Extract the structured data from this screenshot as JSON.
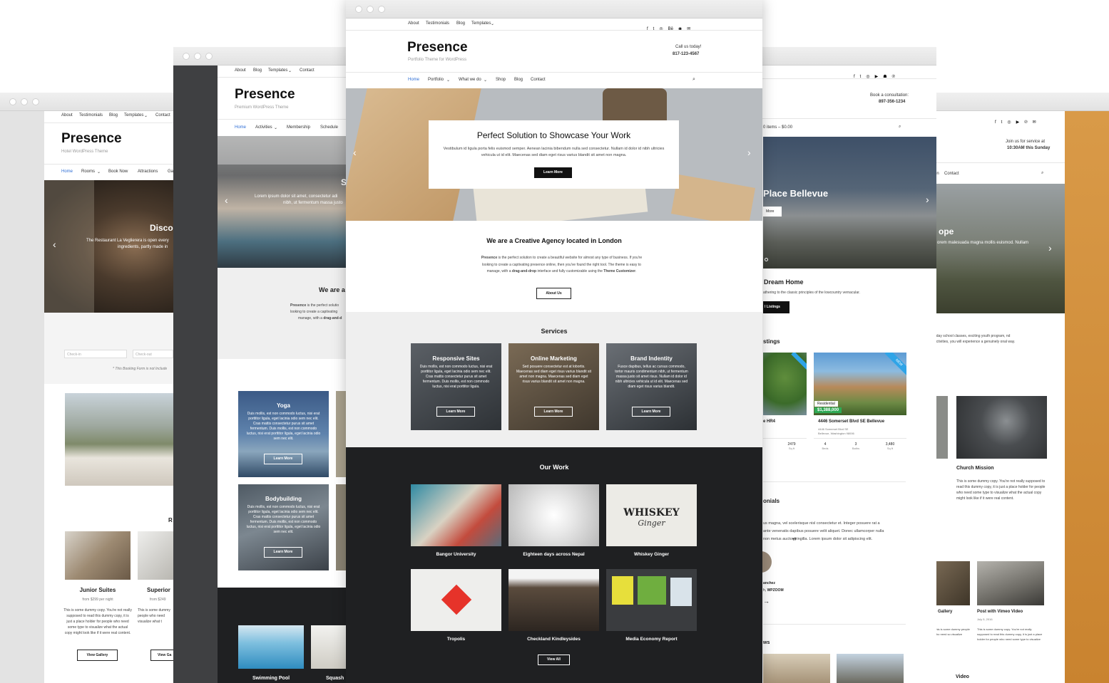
{
  "left_window": {
    "nav": [
      "About",
      "Testimonials",
      "Blog",
      "Templates",
      "Contact"
    ],
    "logo": "Presence",
    "tagline": "Hotel WordPress Theme",
    "menu": [
      "Home",
      "Rooms",
      "Book Now",
      "Attractions",
      "Ga"
    ],
    "hero_title": "Disco",
    "hero_text": "The Restaurant La Veglierera is open every",
    "hero_text2": "ingredients, partly made in",
    "checkin": "Check-in",
    "checkout": "Check-out",
    "booking_note": "* This Booking Form is not Include",
    "rooms_heading": "R",
    "room1_title": "Junior Suites",
    "room1_price": "from $299 per night",
    "room2_title": "Superior",
    "room2_price": "from $249",
    "room_text": "This is some dummy copy. You're not really supposed to read this dummy copy, it is just a place holder for people who need some type to visualize what the actual copy might look like if it were real content.",
    "room_text2": "This is some dummy people who need visualize what t",
    "room1_button": "View Gallery",
    "room2_button": "View Ga"
  },
  "second_window": {
    "nav": [
      "About",
      "Blog",
      "Templates",
      "Contact"
    ],
    "logo": "Presence",
    "tagline": "Premium WordPress Theme",
    "menu": [
      "Home",
      "Activities",
      "Membership",
      "Schedule"
    ],
    "hero_letter": "S",
    "hero_text": "Lorem ipsum dolor sit amet, consectetur adi",
    "hero_text2": "nibh, ut fermentum massa justo",
    "about_heading": "We are a",
    "about_bold": "Presence",
    "about_text": "is the perfect solutio",
    "about_text2": "looking to create a captivating",
    "about_text3": "manage, with a",
    "about_bold2": "drag-and-d",
    "card1_title": "Yoga",
    "card2_title": "Bodybuilding",
    "card_text": "Duis mollis, est non commodo luctus, nisi erat porttitor ligula, eget lacinia odio sem nec elit. Cras mattis consectetur purus sit amet fermentum. Duis mollis, est non commodo luctus, nisi erat porttitor ligula, eget lacinia odio sem nec elit.",
    "card_button": "Learn More",
    "bottom1": "Swimming Pool",
    "bottom2": "Squash"
  },
  "center_window": {
    "nav": [
      "About",
      "Testimonials",
      "Blog",
      "Templates"
    ],
    "social": [
      "f",
      "t",
      "◎",
      "Bē",
      "◉",
      "✉"
    ],
    "logo": "Presence",
    "tagline": "Portfolio Theme for WordPress",
    "call_label": "Call us today!",
    "phone": "817-123-4567",
    "menu": [
      "Home",
      "Portfolio",
      "What we do",
      "Shop",
      "Blog",
      "Contact"
    ],
    "hero_title": "Perfect Solution to Showcase Your Work",
    "hero_text": "Vestibulum id ligula porta felis euismod semper. Aenean lacinia bibendum nulla sed consectetur. Nullam id dolor id nibh ultricies vehicula ut id elit. Maecenas sed diam eget risus varius blandit sit amet non magna.",
    "hero_button": "Learn More",
    "about_heading": "We are a Creative Agency located in London",
    "about_bold": "Presence",
    "about_text": "is the perfect solution to create a beautiful website for almost any type of business. If you're looking to create a captivating presence online, then you've found the right tool. The theme is easy to manage, with a",
    "about_bold2": "drag-and-drop",
    "about_text2": "interface and fully customizable using the",
    "about_bold3": "Theme Customizer",
    "about_button": "About Us",
    "services_heading": "Services",
    "services": [
      {
        "title": "Responsive Sites",
        "text": "Duis mollis, est non commodo luctus, nisi erat porttitor ligula, eget lacinia odio sem nec elit. Cras mattis consectetur purus sit amet fermentum. Duis mollis, est non commodo luctus, nisi erat porttitor ligula.",
        "button": "Learn More"
      },
      {
        "title": "Online Marketing",
        "text": "Sed posuere consectetur est at lobortis. Maecenas sed diam eget risus varius blandit sit amet non magna. Maecenas sed diam eget risus varius blandit sit amet non magna.",
        "button": "Learn More"
      },
      {
        "title": "Brand Indentity",
        "text": "Fusce dapibus, tellus ac cursus commodo, tortor mauris condimentum nibh, ut fermentum massa justo sit amet risus. Nullam id dolor id nibh ultricies vehicula ut id elit. Maecenas sed diam eget risus varius blandit.",
        "button": "Learn More"
      }
    ],
    "work_heading": "Our Work",
    "work": [
      "Bangor University",
      "Eighteen days across Nepal",
      "Whiskey Ginger",
      "Tropolis",
      "Checkland Kindleysides",
      "Media Economy Report"
    ],
    "work_button": "View All"
  },
  "fourth_window": {
    "social": [
      "f",
      "t",
      "◎",
      "▶",
      "☗",
      "℗"
    ],
    "book_label": "Book a consultation:",
    "phone": "897-356-1234",
    "cart": "0 items – $0.00",
    "hero_title": "Place Bellevue",
    "hero_button": "More",
    "dream_title": "Dream Home",
    "dream_text": "athering to the classic principles of the lowcountry vernacular.",
    "dream_button": "l Listings",
    "listings_heading": "stings",
    "listing_name": "4446 Somerset Blvd SE Bellevue",
    "listing_addr": "4446 Somerset Blvd SE",
    "listing_city": "Bellevue, Washington 98006",
    "listing_type": "Residential",
    "listing_price": "$1,388,000",
    "listing_ribbon": "NEW",
    "left_listing_name": "e HR4",
    "left_sqft": "2479",
    "left_sqft_label": "Sq ft",
    "beds": "4",
    "beds_label": "Beds",
    "baths": "3",
    "baths_label": "Baths",
    "sqft": "3,480",
    "sqft_label": "Sq ft",
    "testimonials_heading": "onials",
    "testimonial_text": "us magna, vel scelerisque nisl consectetur et. Integer posuere rat a ante venenatis dapibus posuere velit aliquet. Donec ullamcorper nulla non metus auctor fringilla. Lorem ipsum dolor sit adipiscing elit.",
    "testimonial_name": "anchez",
    "testimonial_role": "h,",
    "testimonial_company": "WPZOOM",
    "news_heading": "ws"
  },
  "right_window": {
    "social": [
      "f",
      "t",
      "◎",
      "▶",
      "℗",
      "✉"
    ],
    "join_label": "Join us for service at",
    "service_time": "10:30AM this Sunday",
    "menu": [
      "on",
      "Contact"
    ],
    "hero_title": "ope",
    "hero_text": "orem malesuada magna mollis euismod. Nullam",
    "intro_text": "nday school classes, exciting youth program, nd activities, you will experience a genuinely onal way.",
    "card_title": "Church Mission",
    "card_text": "This is some dummy copy. You're not really supposed to read this dummy copy, it is just a place holder for people who need some type to visualize what the actual copy might look like if it were real content.",
    "post1_title": "c Gallery",
    "post2_title": "Post with Vimeo Video",
    "post2_date": "July 5, 2016",
    "post_text": "This is some dummy copy. You're not really supposed to read this dummy copy, it is just a place holder for people who need some type to visualize",
    "post1_text": "This is some dummy people who need so visualize",
    "video_heading": "Video"
  },
  "colors": {
    "accent": "#2f6fd6",
    "dark_section": "#1f2022",
    "listing_green": "#2eaa55",
    "ribbon_blue": "#2fa4e7"
  }
}
